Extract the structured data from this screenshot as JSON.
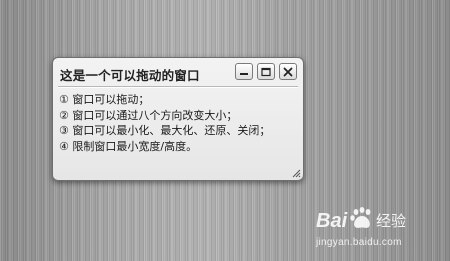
{
  "window": {
    "title": "这是一个可以拖动的窗口",
    "lines": [
      "① 窗口可以拖动；",
      "② 窗口可以通过八个方向改变大小；",
      "③ 窗口可以最小化、最大化、还原、关闭；",
      "④ 限制窗口最小宽度/高度。"
    ],
    "controls": {
      "minimize_icon": "minimize-icon",
      "maximize_icon": "maximize-icon",
      "close_icon": "close-icon"
    }
  },
  "watermark": {
    "brand_text": "Bai",
    "brand_suffix": "经验",
    "url": "jingyan.baidu.com"
  },
  "colors": {
    "window_bg": "#eeeeee",
    "window_border": "#6f6f6f",
    "text": "#1a1a1a"
  }
}
